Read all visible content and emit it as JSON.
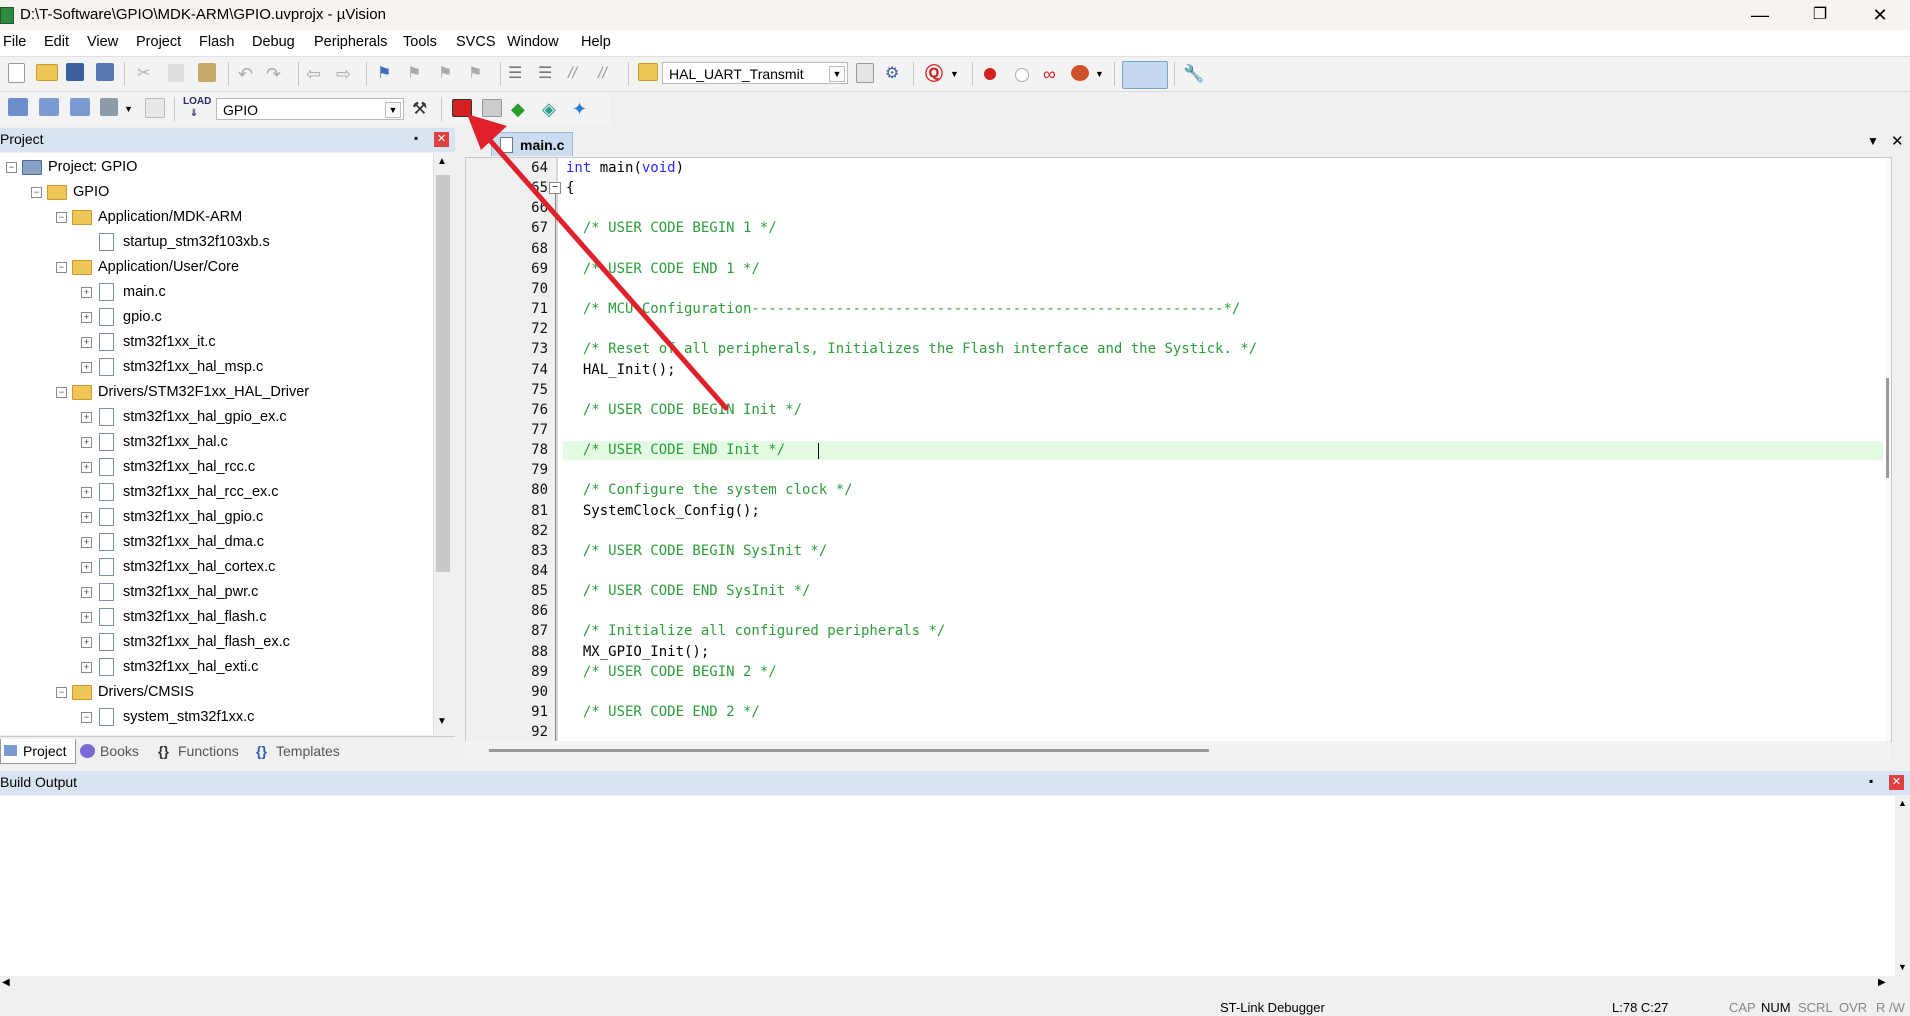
{
  "window": {
    "title": "D:\\T-Software\\GPIO\\MDK-ARM\\GPIO.uvprojx - µVision",
    "minimize": "—",
    "restore": "❐",
    "close": "✕"
  },
  "menu": [
    "File",
    "Edit",
    "View",
    "Project",
    "Flash",
    "Debug",
    "Peripherals",
    "Tools",
    "SVCS",
    "Window",
    "Help"
  ],
  "toolbar": {
    "find_combo": "HAL_UART_Transmit",
    "target_combo": "GPIO"
  },
  "project_panel": {
    "title": "Project",
    "pin": "📌",
    "close": "✕",
    "root": "Project: GPIO",
    "target": "GPIO",
    "groups": [
      {
        "name": "Application/MDK-ARM",
        "files": [
          "startup_stm32f103xb.s"
        ]
      },
      {
        "name": "Application/User/Core",
        "files": [
          "main.c",
          "gpio.c",
          "stm32f1xx_it.c",
          "stm32f1xx_hal_msp.c"
        ]
      },
      {
        "name": "Drivers/STM32F1xx_HAL_Driver",
        "files": [
          "stm32f1xx_hal_gpio_ex.c",
          "stm32f1xx_hal.c",
          "stm32f1xx_hal_rcc.c",
          "stm32f1xx_hal_rcc_ex.c",
          "stm32f1xx_hal_gpio.c",
          "stm32f1xx_hal_dma.c",
          "stm32f1xx_hal_cortex.c",
          "stm32f1xx_hal_pwr.c",
          "stm32f1xx_hal_flash.c",
          "stm32f1xx_hal_flash_ex.c",
          "stm32f1xx_hal_exti.c"
        ]
      },
      {
        "name": "Drivers/CMSIS",
        "files": [
          "system_stm32f1xx.c"
        ]
      }
    ],
    "tabs": [
      "Project",
      "Books",
      "Functions",
      "Templates"
    ]
  },
  "editor": {
    "tab": "main.c",
    "lines": [
      {
        "n": "64",
        "t": "int main(void)"
      },
      {
        "n": "65",
        "t": "{"
      },
      {
        "n": "66",
        "t": ""
      },
      {
        "n": "67",
        "t": "  /* USER CODE BEGIN 1 */"
      },
      {
        "n": "68",
        "t": ""
      },
      {
        "n": "69",
        "t": "  /* USER CODE END 1 */"
      },
      {
        "n": "70",
        "t": ""
      },
      {
        "n": "71",
        "t": "  /* MCU Configuration--------------------------------------------------------*/"
      },
      {
        "n": "72",
        "t": ""
      },
      {
        "n": "73",
        "t": "  /* Reset of all peripherals, Initializes the Flash interface and the Systick. */"
      },
      {
        "n": "74",
        "t": "  HAL_Init();"
      },
      {
        "n": "75",
        "t": ""
      },
      {
        "n": "76",
        "t": "  /* USER CODE BEGIN Init */"
      },
      {
        "n": "77",
        "t": ""
      },
      {
        "n": "78",
        "t": "  /* USER CODE END Init */"
      },
      {
        "n": "79",
        "t": ""
      },
      {
        "n": "80",
        "t": "  /* Configure the system clock */"
      },
      {
        "n": "81",
        "t": "  SystemClock_Config();"
      },
      {
        "n": "82",
        "t": ""
      },
      {
        "n": "83",
        "t": "  /* USER CODE BEGIN SysInit */"
      },
      {
        "n": "84",
        "t": ""
      },
      {
        "n": "85",
        "t": "  /* USER CODE END SysInit */"
      },
      {
        "n": "86",
        "t": ""
      },
      {
        "n": "87",
        "t": "  /* Initialize all configured peripherals */"
      },
      {
        "n": "88",
        "t": "  MX_GPIO_Init();"
      },
      {
        "n": "89",
        "t": "  /* USER CODE BEGIN 2 */"
      },
      {
        "n": "90",
        "t": ""
      },
      {
        "n": "91",
        "t": "  /* USER CODE END 2 */"
      },
      {
        "n": "92",
        "t": ""
      }
    ]
  },
  "build_output": {
    "title": "Build Output"
  },
  "status": {
    "debugger": "ST-Link Debugger",
    "position": "L:78 C:27",
    "cap": "CAP",
    "num": "NUM",
    "scrl": "SCRL",
    "ovr": "OVR",
    "rw": "R /W"
  },
  "colors": {
    "annotation_arrow": "#e0202a",
    "comment": "#2c9e3a",
    "keyword": "#2a2aff",
    "current_line": "#e3fbe3"
  }
}
